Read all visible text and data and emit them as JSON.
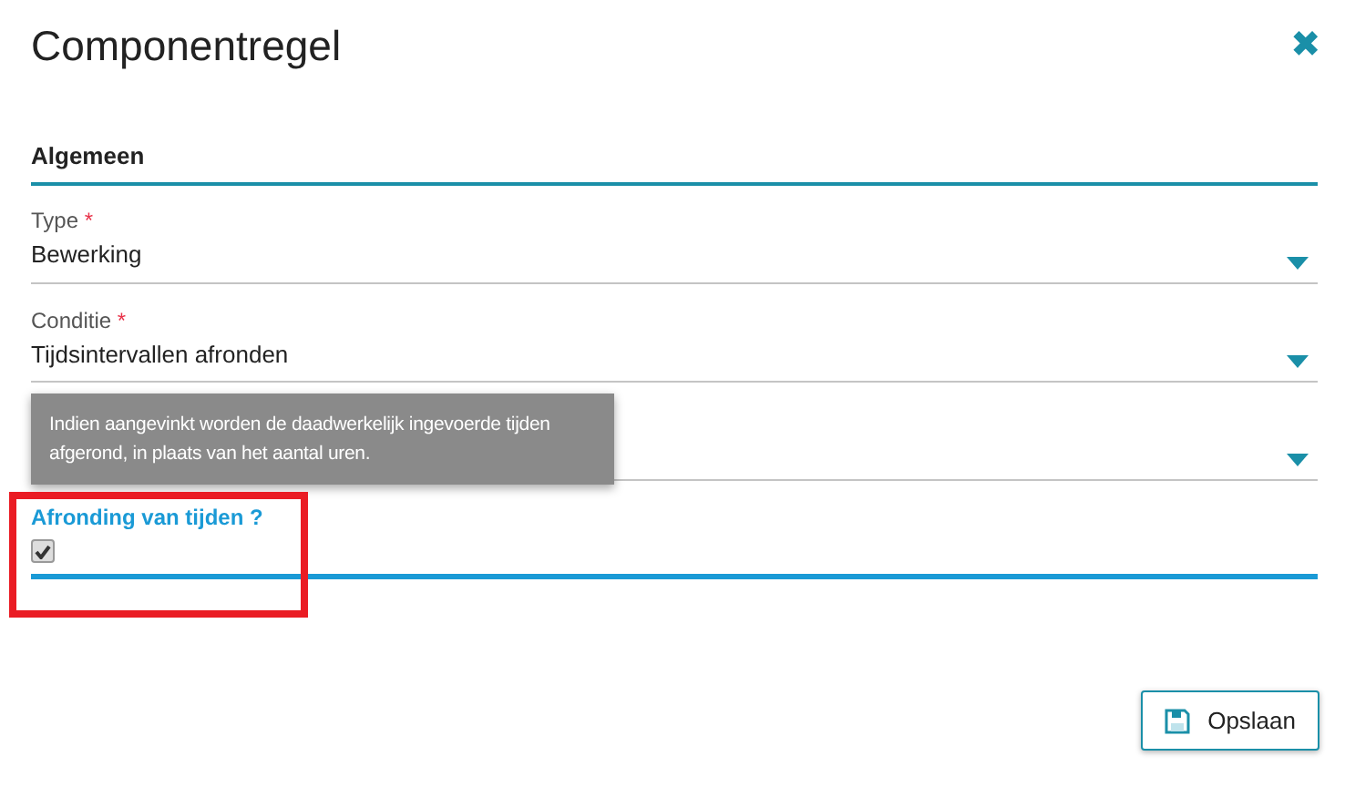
{
  "dialog": {
    "title": "Componentregel",
    "close_icon": "✖"
  },
  "section": {
    "title": "Algemeen"
  },
  "fields": [
    {
      "kind": "select",
      "label": "Type",
      "required_mark": "*",
      "value": "Bewerking"
    },
    {
      "kind": "select",
      "label": "Conditie",
      "required_mark": "*",
      "value": "Tijdsintervallen afronden"
    },
    {
      "kind": "select"
    },
    {
      "kind": "checkbox",
      "label": "Afronding van tijden",
      "help": "?",
      "checked": true,
      "focused": true,
      "highlighted": true
    }
  ],
  "tooltip": {
    "text": "Indien aangevinkt worden de daadwerkelijk ingevoerde tijden afgerond, in plaats van het aantal uren."
  },
  "buttons": [
    {
      "label": "Opslaan"
    }
  ]
}
